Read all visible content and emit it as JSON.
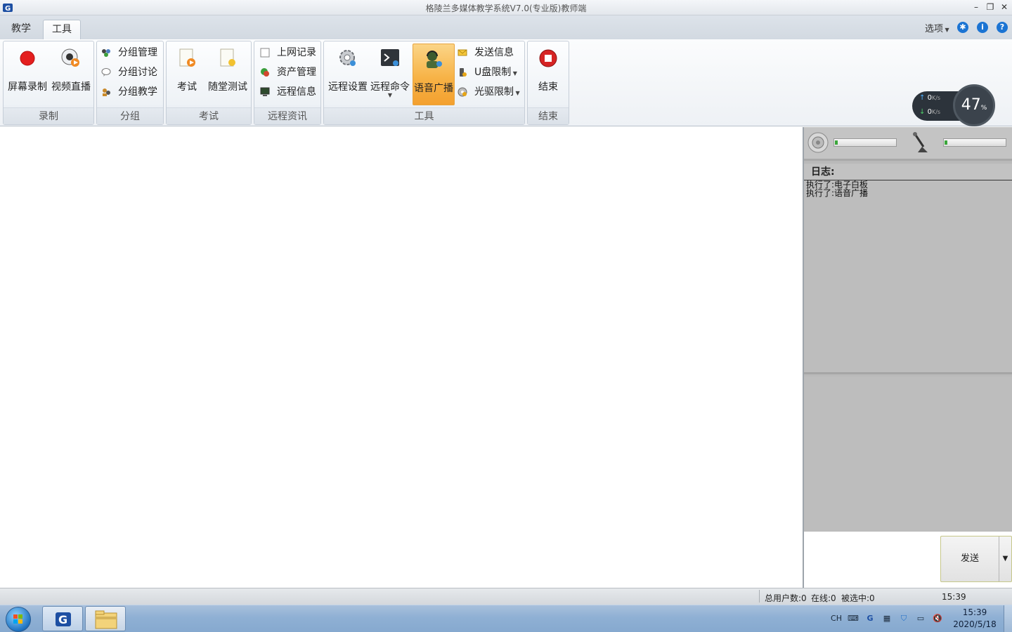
{
  "window": {
    "title": "格陵兰多媒体教学系统V7.0(专业版)教师端",
    "minimize_icon": "minimize-icon",
    "restore_icon": "restore-icon",
    "close_icon": "close-icon"
  },
  "tabs": [
    {
      "label": "教学",
      "active": false
    },
    {
      "label": "工具",
      "active": true
    }
  ],
  "header_right": {
    "options_label": "选项",
    "settings_icon": "gear-icon",
    "info_icon": "info-icon",
    "help_icon": "help-icon"
  },
  "ribbon": {
    "groups": [
      {
        "label": "录制",
        "buttons": [
          "屏幕录制",
          "视频直播"
        ]
      },
      {
        "label": "分组",
        "buttons": [
          "分组管理",
          "分组讨论",
          "分组教学"
        ]
      },
      {
        "label": "考试",
        "buttons": [
          "考试",
          "随堂测试"
        ]
      },
      {
        "label": "远程资讯",
        "buttons": [
          "上网记录",
          "资产管理",
          "远程信息"
        ]
      },
      {
        "label": "工具",
        "buttons": [
          "远程设置",
          "远程命令",
          "语音广播",
          "发送信息",
          "U盘限制",
          "光驱限制"
        ],
        "selected": "语音广播"
      },
      {
        "label": "结束",
        "buttons": [
          "结束"
        ]
      }
    ]
  },
  "network": {
    "upload": "0",
    "download": "0",
    "unit": "K/s",
    "usage_percent": "47",
    "percent_sign": "%"
  },
  "right_panel": {
    "speaker_level": 0.05,
    "mic_level": 0.05,
    "log_title": "日志:",
    "log_entries": [
      "执行了:电子白板",
      "执行了:语音广播"
    ],
    "send_label": "发送"
  },
  "status": {
    "total_users": "总用户数:0",
    "online": "在线:0",
    "selected": "被选中:0",
    "time": "15:39"
  },
  "taskbar": {
    "lang": "CH",
    "clock_time": "15:39",
    "clock_date": "2020/5/18"
  }
}
